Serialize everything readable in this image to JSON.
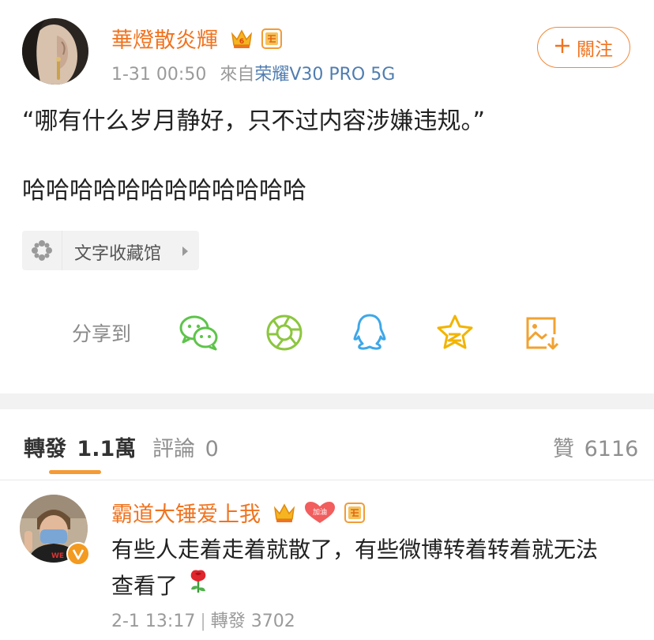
{
  "post": {
    "author": "華燈散炎輝",
    "time": "1-31 00:50",
    "source_prefix": "來自",
    "device": "荣耀V30 PRO 5G",
    "follow_label": "關注",
    "content_line1": "“哪有什么岁月静好，只不过内容涉嫌违规。”",
    "content_line2": "哈哈哈哈哈哈哈哈哈哈哈哈",
    "topic_label": "文字收藏馆"
  },
  "share": {
    "label": "分享到",
    "targets": [
      "wechat-icon",
      "moments-icon",
      "qq-icon",
      "qzone-icon",
      "save-image-icon"
    ]
  },
  "tabs": {
    "repost_label": "轉發",
    "repost_count": "1.1萬",
    "comment_label": "評論",
    "comment_count": "0",
    "like_label": "贊",
    "like_count": "6116"
  },
  "repost": {
    "author": "霸道大锤爱上我",
    "line1": "有些人走着走着就散了，有些微博转着转着就无法",
    "line2": "查看了",
    "time": "2-1 13:17",
    "repost_label": "轉發",
    "repost_count": "3702",
    "badge_text": "加油"
  },
  "colors": {
    "accent_orange": "#f0731f",
    "device_blue": "#4f7db0",
    "wechat_green": "#5ec44a",
    "qq_blue": "#3ea7e8",
    "qzone_yellow": "#f2b400"
  }
}
